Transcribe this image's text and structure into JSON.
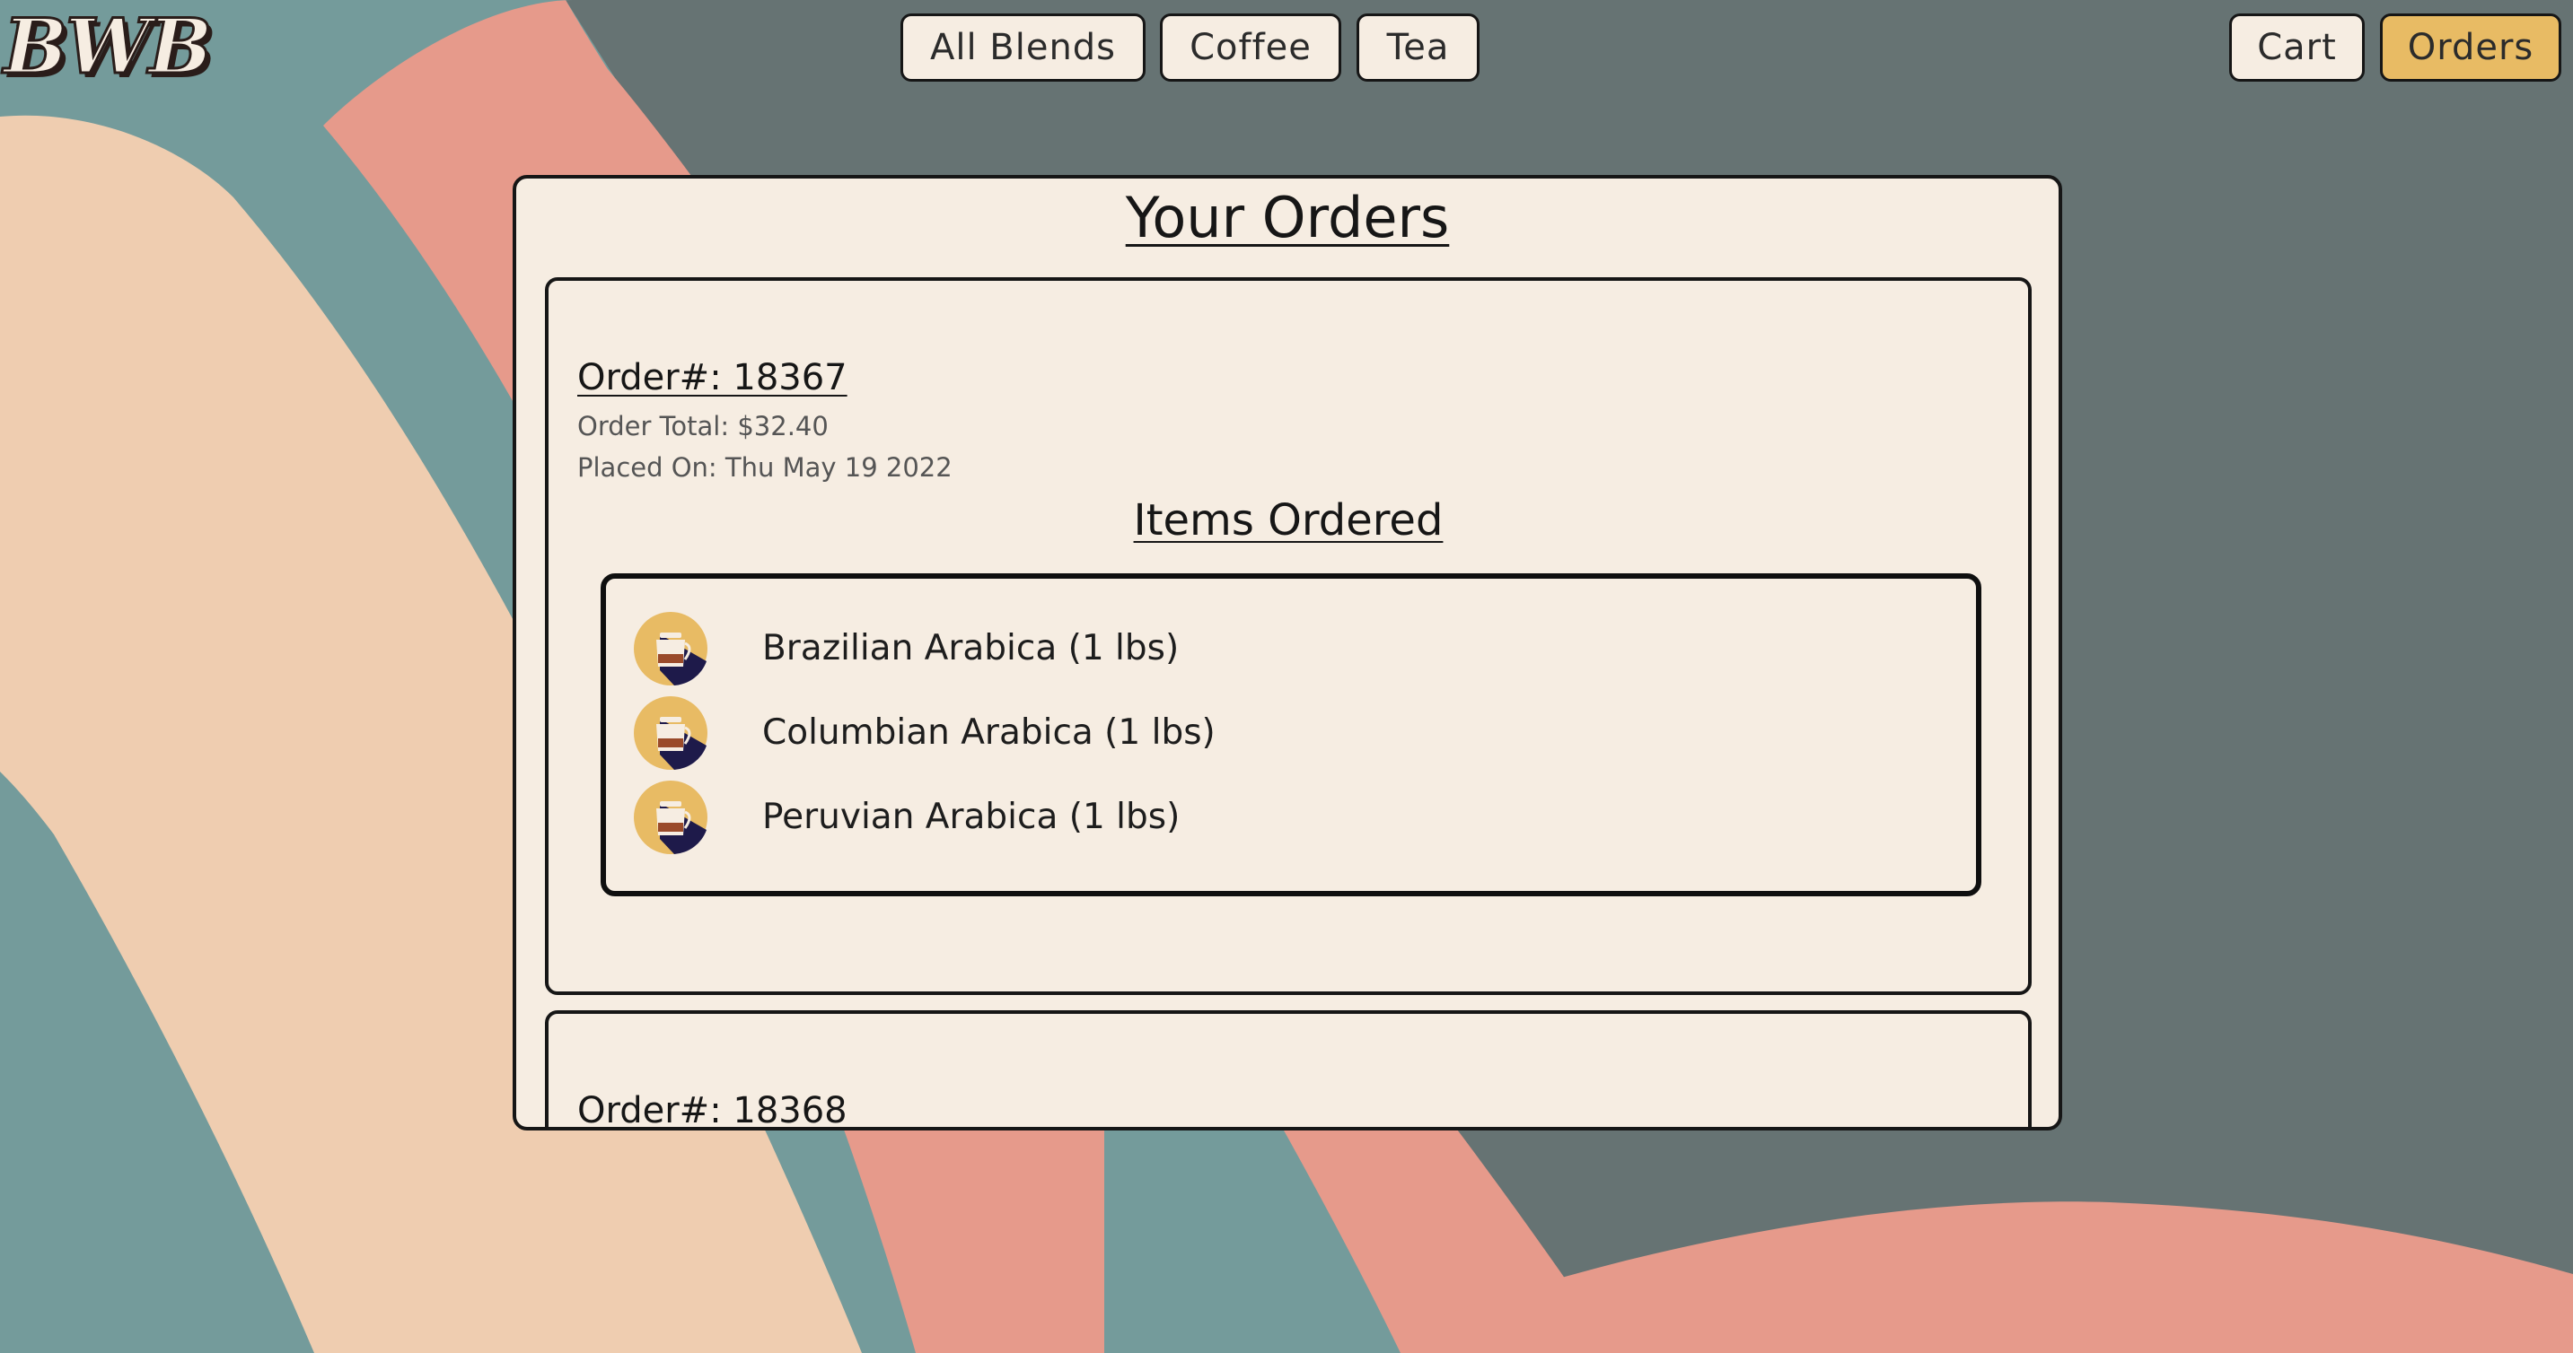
{
  "app": {
    "logo_text": "BWB"
  },
  "nav": {
    "all_blends": "All Blends",
    "coffee": "Coffee",
    "tea": "Tea",
    "cart": "Cart",
    "orders": "Orders",
    "active": "orders"
  },
  "colors": {
    "panel_bg": "#f6ede2",
    "active_button": "#e8bb64",
    "bg_slate": "#667373",
    "bg_teal": "#749b9b",
    "bg_salmon": "#e69a8b",
    "bg_peach": "#efcdb0"
  },
  "page": {
    "title": "Your Orders"
  },
  "orders": [
    {
      "number_label": "Order#: 18367",
      "total_label": "Order Total: $32.40",
      "placed_label": "Placed On: Thu May 19 2022",
      "items_title": "Items Ordered",
      "items": [
        {
          "icon": "coffee-pot-icon",
          "name": "Brazilian Arabica (1 lbs)"
        },
        {
          "icon": "coffee-pot-icon",
          "name": "Columbian Arabica (1 lbs)"
        },
        {
          "icon": "coffee-pot-icon",
          "name": "Peruvian Arabica (1 lbs)"
        }
      ]
    },
    {
      "number_label": "Order#: 18368"
    }
  ]
}
